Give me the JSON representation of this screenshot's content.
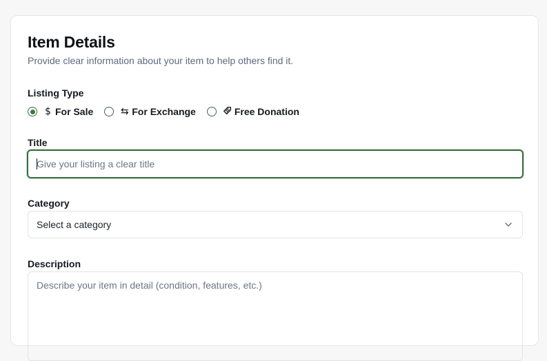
{
  "form": {
    "title": "Item Details",
    "subtitle": "Provide clear information about your item to help others find it.",
    "listing_type": {
      "label": "Listing Type",
      "options": [
        {
          "icon": "dollar-icon",
          "glyph": "$",
          "label": "For Sale",
          "checked": true
        },
        {
          "icon": "exchange-icon",
          "glyph": "⇆",
          "label": "For Exchange",
          "checked": false
        },
        {
          "icon": "gift-icon",
          "glyph": "⛓",
          "label": "Free Donation",
          "checked": false
        }
      ]
    },
    "title_field": {
      "label": "Title",
      "placeholder": "Give your listing a clear title",
      "value": ""
    },
    "category": {
      "label": "Category",
      "selected": "Select a category"
    },
    "description": {
      "label": "Description",
      "placeholder": "Describe your item in detail (condition, features, etc.)"
    }
  },
  "colors": {
    "accent": "#3a7a3e",
    "muted_text": "#5b6b7c",
    "border": "#e0e3e7"
  }
}
